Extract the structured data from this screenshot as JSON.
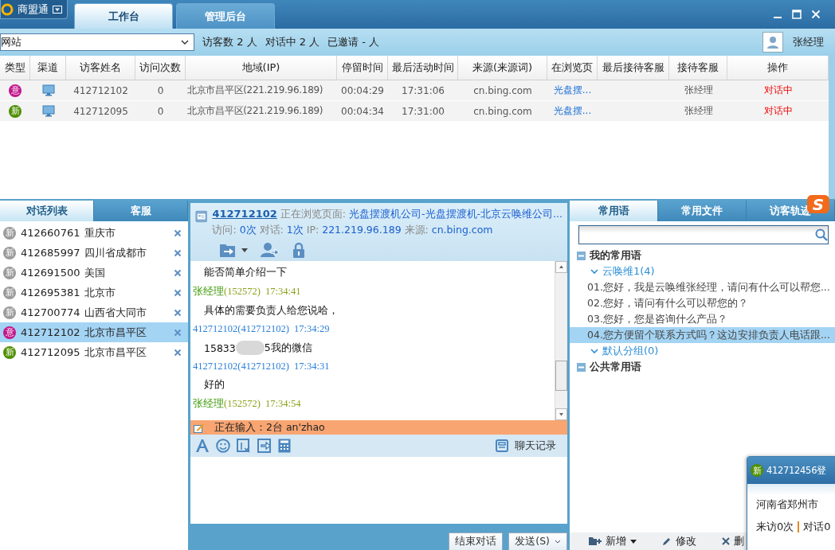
{
  "app_menu": {
    "label": "商盟通"
  },
  "main_tabs": [
    {
      "label": "工作台",
      "selected": true
    },
    {
      "label": "管理后台",
      "selected": false
    }
  ],
  "toolbar": {
    "site_select": "网站",
    "stats": [
      "访客数 2 人",
      "对话中 2 人",
      "已邀请 - 人"
    ],
    "user": "张经理"
  },
  "visitor_table": {
    "columns": [
      "类型",
      "渠道",
      "访客姓名",
      "访问次数",
      "地域(IP)",
      "停留时间",
      "最后活动时间",
      "来源(来源词)",
      "在浏览页",
      "最后接待客服",
      "接待客服",
      "操作"
    ],
    "rows": [
      {
        "type": "意",
        "color": "#c2188c",
        "name": "412712102",
        "visits": "0",
        "region": "北京市昌平区(221.219.96.189)",
        "stay": "00:04:29",
        "last_active": "17:31:06",
        "source": "cn.bing.com",
        "page": "光盘摆...",
        "agent": "张经理",
        "status": "对话中"
      },
      {
        "type": "新",
        "color": "#4f8f00",
        "name": "412712095",
        "visits": "0",
        "region": "北京市昌平区(221.219.96.189)",
        "stay": "00:04:34",
        "last_active": "17:31:00",
        "source": "cn.bing.com",
        "page": "光盘摆...",
        "agent": "张经理",
        "status": "对话中"
      }
    ]
  },
  "left_panel": {
    "tabs": [
      {
        "label": "对话列表",
        "selected": true
      },
      {
        "label": "客服",
        "selected": false
      }
    ],
    "conversations": [
      {
        "badge": "新",
        "color": "#9a9a9a",
        "id": "412660761",
        "city": "重庆市",
        "selected": false
      },
      {
        "badge": "新",
        "color": "#9a9a9a",
        "id": "412685997",
        "city": "四川省成都市",
        "selected": false
      },
      {
        "badge": "新",
        "color": "#9a9a9a",
        "id": "412691500",
        "city": "美国",
        "selected": false
      },
      {
        "badge": "新",
        "color": "#9a9a9a",
        "id": "412695381",
        "city": "北京市",
        "selected": false
      },
      {
        "badge": "新",
        "color": "#9a9a9a",
        "id": "412700774",
        "city": "山西省大同市",
        "selected": false
      },
      {
        "badge": "意",
        "color": "#c2188c",
        "id": "412712102",
        "city": "北京市昌平区",
        "selected": true
      },
      {
        "badge": "新",
        "color": "#4f8f00",
        "id": "412712095",
        "city": "北京市昌平区",
        "selected": false
      }
    ]
  },
  "chat": {
    "visitor_id": "412712102",
    "browsing_label": "正在浏览页面:",
    "browsing_page": "光盘摆渡机公司-光盘摆渡机-北京云唤维公司...",
    "stats": [
      {
        "label": "访问:",
        "value": "0次"
      },
      {
        "label": "对话:",
        "value": "1次"
      },
      {
        "label": "IP:",
        "value": "221.219.96.189"
      },
      {
        "label": "来源:",
        "value": "cn.bing.com"
      }
    ],
    "messages": [
      {
        "kind": "body",
        "text": "能否简单介绍一下"
      },
      {
        "kind": "agent",
        "name": "张经理",
        "code": "(152572)",
        "time": "17:34:41"
      },
      {
        "kind": "body",
        "text": "具体的需要负责人给您说哈，"
      },
      {
        "kind": "visitor",
        "name": "412712102(412712102)",
        "time": "17:34:29"
      },
      {
        "kind": "redacted",
        "text": "15833",
        "text_after": "5我的微信"
      },
      {
        "kind": "visitor",
        "name": "412712102(412712102)",
        "time": "17:34:31"
      },
      {
        "kind": "body",
        "text": "好的"
      },
      {
        "kind": "agent",
        "name": "张经理",
        "code": "(152572)",
        "time": "17:34:54"
      }
    ],
    "typing": "正在输入：2台   an'zhao",
    "history_label": "聊天记录",
    "end_button": "结束对话",
    "send_button": "发送(S)"
  },
  "right_panel": {
    "tabs": [
      {
        "label": "常用语",
        "selected": true
      },
      {
        "label": "常用文件",
        "selected": false
      },
      {
        "label": "访客轨迹",
        "selected": false
      }
    ],
    "ime_badge": "S",
    "tree": [
      {
        "label": "我的常用语",
        "expanded": true,
        "children": [
          {
            "label": "云唤维1(4)",
            "expanded": true,
            "children": [
              {
                "label": "01.您好，我是云唤维张经理，请问有什么可以帮您...",
                "selected": false
              },
              {
                "label": "02.您好，请问有什么可以帮您的？",
                "selected": false
              },
              {
                "label": "03.您好，您是咨询什么产品？",
                "selected": false
              },
              {
                "label": "04.您方便留个联系方式吗？这边安排负责人电话跟...",
                "selected": true
              }
            ]
          },
          {
            "label": "默认分组(0)",
            "expanded": true
          }
        ]
      },
      {
        "label": "公共常用语",
        "expanded": true
      }
    ],
    "actions": [
      {
        "kind": "add",
        "label": "新增"
      },
      {
        "kind": "edit",
        "label": "修改"
      },
      {
        "kind": "delete",
        "label": "删"
      }
    ]
  },
  "popup": {
    "badge": "新",
    "color": "#4f8f00",
    "title": "412712456登",
    "lines": [
      [
        "河南省郑州市"
      ],
      [
        "来访0次",
        "对话0"
      ]
    ]
  }
}
